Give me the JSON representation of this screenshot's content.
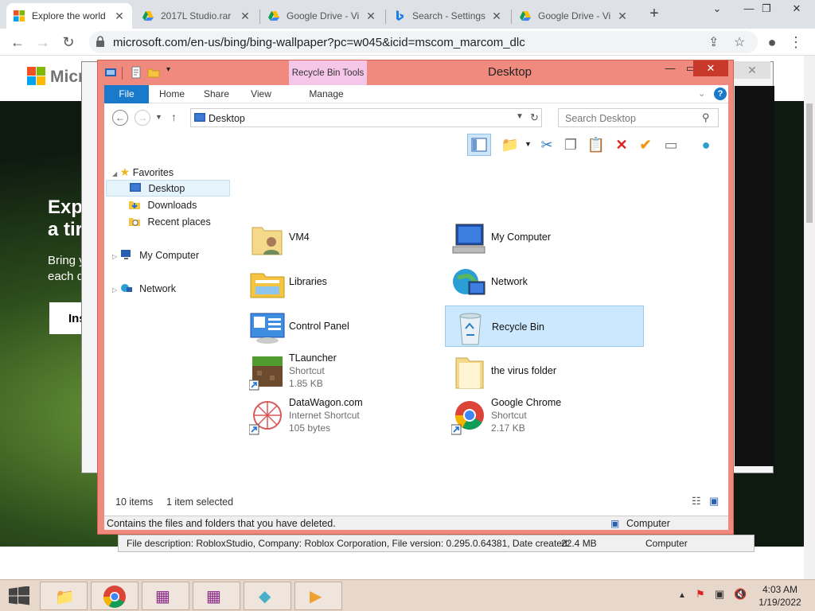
{
  "browser": {
    "tabs": [
      {
        "title": "Explore the world",
        "active": true
      },
      {
        "title": "2017L Studio.rar"
      },
      {
        "title": "Google Drive - Vi"
      },
      {
        "title": "Search - Settings"
      },
      {
        "title": "Google Drive - Vi"
      }
    ],
    "url": "microsoft.com/en-us/bing/bing-wallpaper?pc=w045&icid=mscom_marcom_dlc"
  },
  "page": {
    "brand": "Micr",
    "hero_line1": "Expl",
    "hero_line2": "a tir",
    "hero_line3": "Bring y",
    "hero_line4": "each d",
    "hero_button": "Ins"
  },
  "background_window": {
    "status": "File description: RobloxStudio, Company: Roblox Corporation, File version: 0.295.0.64381, Date created:",
    "size": "22.4 MB",
    "location": "Computer"
  },
  "explorer": {
    "title": "Desktop",
    "context_tab": "Recycle Bin Tools",
    "ribbon_tabs": [
      "File",
      "Home",
      "Share",
      "View",
      "Manage"
    ],
    "address": "Desktop",
    "search_placeholder": "Search Desktop",
    "nav": {
      "favorites": "Favorites",
      "desktop": "Desktop",
      "downloads": "Downloads",
      "recent": "Recent places",
      "computer": "My Computer",
      "network": "Network"
    },
    "items": [
      {
        "name": "VM4",
        "sub1": "",
        "sub2": ""
      },
      {
        "name": "My Computer",
        "sub1": "",
        "sub2": ""
      },
      {
        "name": "Libraries",
        "sub1": "",
        "sub2": ""
      },
      {
        "name": "Network",
        "sub1": "",
        "sub2": ""
      },
      {
        "name": "Control Panel",
        "sub1": "",
        "sub2": ""
      },
      {
        "name": "Recycle Bin",
        "sub1": "",
        "sub2": "",
        "selected": true
      },
      {
        "name": "TLauncher",
        "sub1": "Shortcut",
        "sub2": "1.85 KB"
      },
      {
        "name": "the virus folder",
        "sub1": "",
        "sub2": ""
      },
      {
        "name": "DataWagon.com",
        "sub1": "Internet Shortcut",
        "sub2": "105 bytes"
      },
      {
        "name": "Google Chrome",
        "sub1": "Shortcut",
        "sub2": "2.17 KB"
      }
    ],
    "status_count": "10 items",
    "status_selected": "1 item selected",
    "description": "Contains the files and folders that you have deleted.",
    "location": "Computer"
  },
  "taskbar": {
    "time": "4:03 AM",
    "date": "1/19/2022"
  }
}
